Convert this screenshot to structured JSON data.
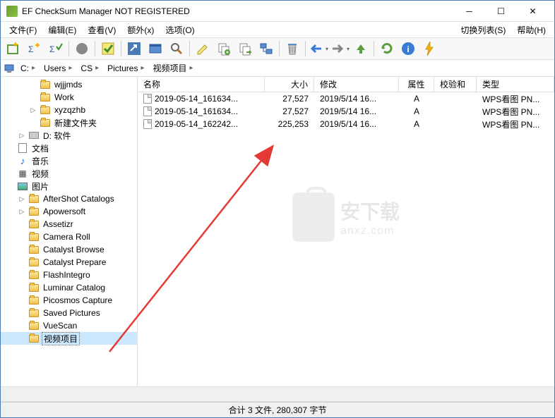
{
  "title": "EF CheckSum Manager NOT REGISTERED",
  "menu": {
    "file": "文件(F)",
    "edit": "编辑(E)",
    "view": "查看(V)",
    "extra": "额外(x)",
    "options": "选项(O)",
    "switch_list": "切换列表(S)",
    "help": "帮助(H)"
  },
  "breadcrumb": [
    "C:",
    "Users",
    "CS",
    "Pictures",
    "视频项目"
  ],
  "tree": [
    {
      "depth": 2,
      "exp": "",
      "icon": "folder",
      "label": "wjjjmds"
    },
    {
      "depth": 2,
      "exp": "",
      "icon": "folder",
      "label": "Work"
    },
    {
      "depth": 2,
      "exp": "▷",
      "icon": "folder",
      "label": "xyzqzhb"
    },
    {
      "depth": 2,
      "exp": "",
      "icon": "folder",
      "label": "新建文件夹"
    },
    {
      "depth": 1,
      "exp": "▷",
      "icon": "drive",
      "label": "D: 软件"
    },
    {
      "depth": 0,
      "exp": "",
      "icon": "doc",
      "label": "文档"
    },
    {
      "depth": 0,
      "exp": "",
      "icon": "music",
      "label": "音乐"
    },
    {
      "depth": 0,
      "exp": "",
      "icon": "video",
      "label": "视频"
    },
    {
      "depth": 0,
      "exp": "",
      "icon": "pic",
      "label": "图片"
    },
    {
      "depth": 1,
      "exp": "▷",
      "icon": "folder",
      "label": "AfterShot Catalogs"
    },
    {
      "depth": 1,
      "exp": "▷",
      "icon": "folder",
      "label": "Apowersoft"
    },
    {
      "depth": 1,
      "exp": "",
      "icon": "folder",
      "label": "Assetizr"
    },
    {
      "depth": 1,
      "exp": "",
      "icon": "folder",
      "label": "Camera Roll"
    },
    {
      "depth": 1,
      "exp": "",
      "icon": "folder",
      "label": "Catalyst Browse"
    },
    {
      "depth": 1,
      "exp": "",
      "icon": "folder",
      "label": "Catalyst Prepare"
    },
    {
      "depth": 1,
      "exp": "",
      "icon": "folder",
      "label": "FlashIntegro"
    },
    {
      "depth": 1,
      "exp": "",
      "icon": "folder",
      "label": "Luminar Catalog"
    },
    {
      "depth": 1,
      "exp": "",
      "icon": "folder",
      "label": "Picosmos Capture"
    },
    {
      "depth": 1,
      "exp": "",
      "icon": "folder",
      "label": "Saved Pictures"
    },
    {
      "depth": 1,
      "exp": "",
      "icon": "folder",
      "label": "VueScan"
    },
    {
      "depth": 1,
      "exp": "",
      "icon": "folder",
      "label": "视频项目",
      "selected": true
    }
  ],
  "columns": {
    "name": "名称",
    "size": "大小",
    "modified": "修改",
    "attr": "属性",
    "checksum": "校验和",
    "type": "类型"
  },
  "files": [
    {
      "name": "2019-05-14_161634...",
      "size": "27,527",
      "modified": "2019/5/14  16...",
      "attr": "A",
      "type": "WPS看图 PN..."
    },
    {
      "name": "2019-05-14_161634...",
      "size": "27,527",
      "modified": "2019/5/14  16...",
      "attr": "A",
      "type": "WPS看图 PN..."
    },
    {
      "name": "2019-05-14_162242...",
      "size": "225,253",
      "modified": "2019/5/14  16...",
      "attr": "A",
      "type": "WPS看图 PN..."
    }
  ],
  "watermark": {
    "cn": "安下载",
    "en": "anxz.com"
  },
  "status": "合计 3 文件, 280,307 字节"
}
